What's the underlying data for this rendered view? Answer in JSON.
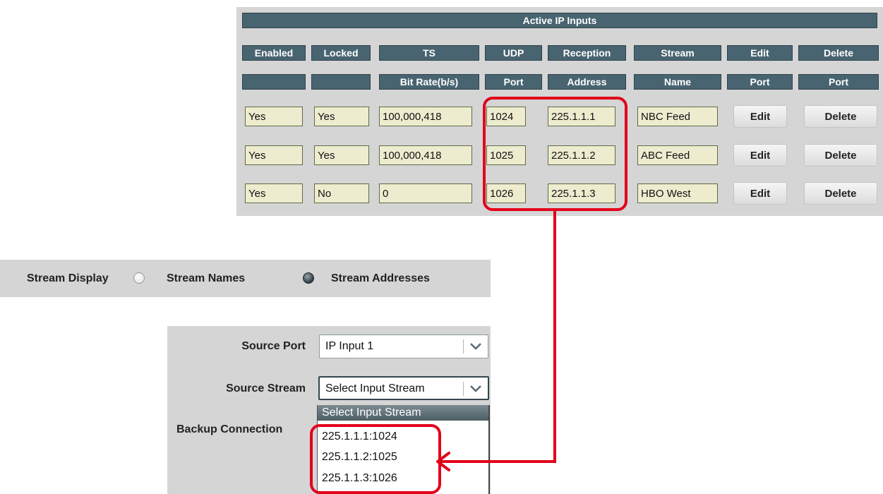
{
  "table": {
    "title": "Active IP Inputs",
    "header_row1": [
      "Enabled",
      "Locked",
      "TS",
      "UDP",
      "Reception",
      "Stream",
      "Edit",
      "Delete"
    ],
    "header_row2": [
      "",
      "",
      "Bit Rate(b/s)",
      "Port",
      "Address",
      "Name",
      "Port",
      "Port"
    ],
    "rows": [
      {
        "enabled": "Yes",
        "locked": "Yes",
        "bitrate": "100,000,418",
        "port": "1024",
        "address": "225.1.1.1",
        "name": "NBC Feed",
        "edit": "Edit",
        "delete": "Delete"
      },
      {
        "enabled": "Yes",
        "locked": "Yes",
        "bitrate": "100,000,418",
        "port": "1025",
        "address": "225.1.1.2",
        "name": "ABC Feed",
        "edit": "Edit",
        "delete": "Delete"
      },
      {
        "enabled": "Yes",
        "locked": "No",
        "bitrate": "0",
        "port": "1026",
        "address": "225.1.1.3",
        "name": "HBO West",
        "edit": "Edit",
        "delete": "Delete"
      }
    ]
  },
  "stream_display": {
    "label": "Stream Display",
    "options": [
      {
        "label": "Stream Names",
        "selected": false
      },
      {
        "label": "Stream Addresses",
        "selected": true
      }
    ]
  },
  "source": {
    "port_label": "Source Port",
    "port_value": "IP Input 1",
    "stream_label": "Source Stream",
    "stream_value": "Select Input Stream",
    "backup_label": "Backup Connection",
    "dropdown_header": "Select Input Stream",
    "dropdown_items": [
      "225.1.1.1:1024",
      "225.1.1.2:1025",
      "225.1.1.3:1026"
    ]
  },
  "colors": {
    "header_bg": "#486470",
    "value_bg": "#eeeccf",
    "panel_bg": "#d5d5d5",
    "annotation": "#e2001a"
  },
  "icons": [
    "chevron-down-icon",
    "radio-unselected-icon",
    "radio-selected-icon"
  ]
}
